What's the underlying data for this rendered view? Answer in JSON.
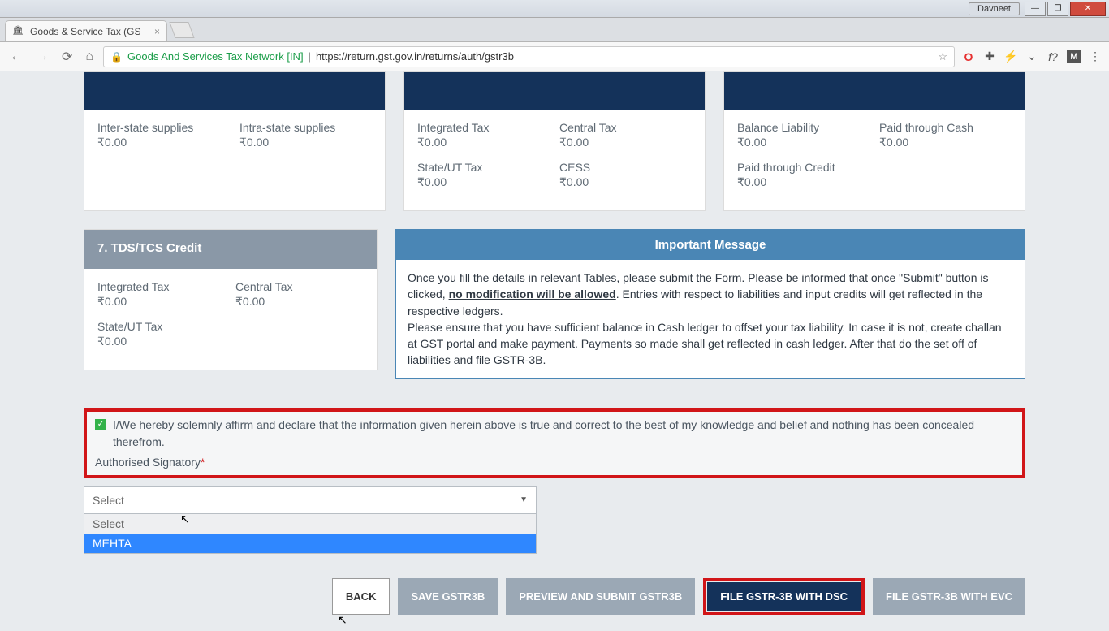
{
  "window": {
    "user_button": "Davneet"
  },
  "tab": {
    "title": "Goods & Service Tax (GS"
  },
  "address": {
    "origin": "Goods And Services Tax Network [IN]",
    "url": "https://return.gst.gov.in/returns/auth/gstr3b"
  },
  "cards": {
    "supplies": {
      "inter_label": "Inter-state supplies",
      "inter_val": "₹0.00",
      "intra_label": "Intra-state supplies",
      "intra_val": "₹0.00"
    },
    "tax": {
      "igst_label": "Integrated Tax",
      "igst_val": "₹0.00",
      "cgst_label": "Central Tax",
      "cgst_val": "₹0.00",
      "sgst_label": "State/UT Tax",
      "sgst_val": "₹0.00",
      "cess_label": "CESS",
      "cess_val": "₹0.00"
    },
    "liability": {
      "bal_label": "Balance Liability",
      "bal_val": "₹0.00",
      "cash_label": "Paid through Cash",
      "cash_val": "₹0.00",
      "credit_label": "Paid through Credit",
      "credit_val": "₹0.00"
    }
  },
  "tds": {
    "title": "7. TDS/TCS Credit",
    "igst_label": "Integrated Tax",
    "igst_val": "₹0.00",
    "cgst_label": "Central Tax",
    "cgst_val": "₹0.00",
    "sgst_label": "State/UT Tax",
    "sgst_val": "₹0.00"
  },
  "message": {
    "title": "Important Message",
    "p1a": "Once you fill the details in relevant Tables, please submit the Form. Please be informed that once \"Submit\" button is clicked, ",
    "p1b": "no modification will be allowed",
    "p1c": ". Entries with respect to liabilities and input credits will get reflected in the respective ledgers.",
    "p2": "Please ensure that you have sufficient balance in Cash ledger to offset your tax liability. In case it is not, create challan at GST portal and make payment. Payments so made shall get reflected in cash ledger. After that do the set off of liabilities and file GSTR-3B."
  },
  "declaration": {
    "text": "I/We hereby solemnly affirm and declare that the information given herein above is true and correct to the best of my knowledge and belief and nothing has been concealed therefrom.",
    "auth_label": "Authorised Signatory"
  },
  "select": {
    "placeholder": "Select",
    "opt_select": "Select",
    "opt_mehta": "MEHTA"
  },
  "buttons": {
    "back": "BACK",
    "save": "SAVE GSTR3B",
    "preview": "PREVIEW AND SUBMIT GSTR3B",
    "dsc": "FILE GSTR-3B WITH DSC",
    "evc": "FILE GSTR-3B WITH EVC"
  }
}
